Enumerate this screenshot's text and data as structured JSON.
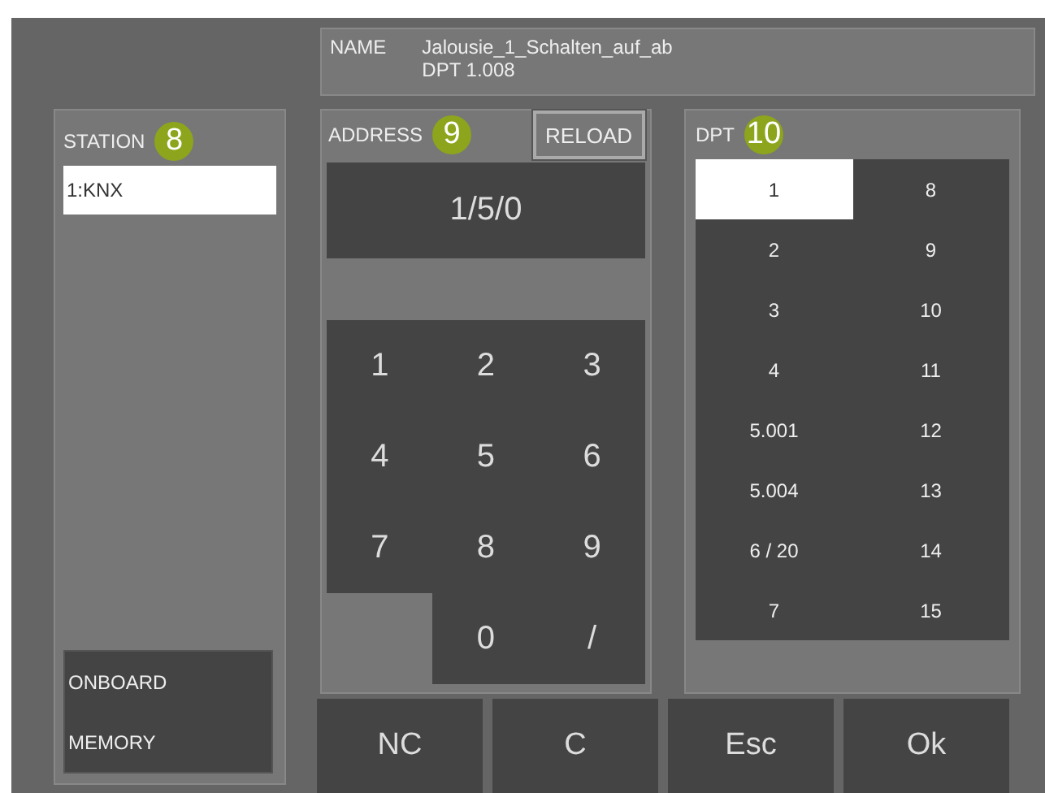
{
  "name_box": {
    "label": "NAME",
    "value": "Jalousie_1_Schalten_auf_ab",
    "dpt": "DPT 1.008"
  },
  "station": {
    "title": "STATION",
    "badge": "8",
    "items": [
      {
        "label": "1:KNX",
        "selected": true
      }
    ],
    "sources": [
      "ONBOARD",
      "MEMORY"
    ]
  },
  "address": {
    "title": "ADDRESS",
    "badge": "9",
    "reload": "RELOAD",
    "value": "1/5/0",
    "keys": [
      "1",
      "2",
      "3",
      "4",
      "5",
      "6",
      "7",
      "8",
      "9",
      "0",
      "/"
    ]
  },
  "dpt": {
    "title": "DPT",
    "badge": "10",
    "items": [
      {
        "label": "1",
        "selected": true
      },
      {
        "label": "8",
        "selected": false
      },
      {
        "label": "2",
        "selected": false
      },
      {
        "label": "9",
        "selected": false
      },
      {
        "label": "3",
        "selected": false
      },
      {
        "label": "10",
        "selected": false
      },
      {
        "label": "4",
        "selected": false
      },
      {
        "label": "11",
        "selected": false
      },
      {
        "label": "5.001",
        "selected": false
      },
      {
        "label": "12",
        "selected": false
      },
      {
        "label": "5.004",
        "selected": false
      },
      {
        "label": "13",
        "selected": false
      },
      {
        "label": "6 / 20",
        "selected": false
      },
      {
        "label": "14",
        "selected": false
      },
      {
        "label": "7",
        "selected": false
      },
      {
        "label": "15",
        "selected": false
      }
    ]
  },
  "buttons": [
    "NC",
    "C",
    "Esc",
    "Ok"
  ]
}
